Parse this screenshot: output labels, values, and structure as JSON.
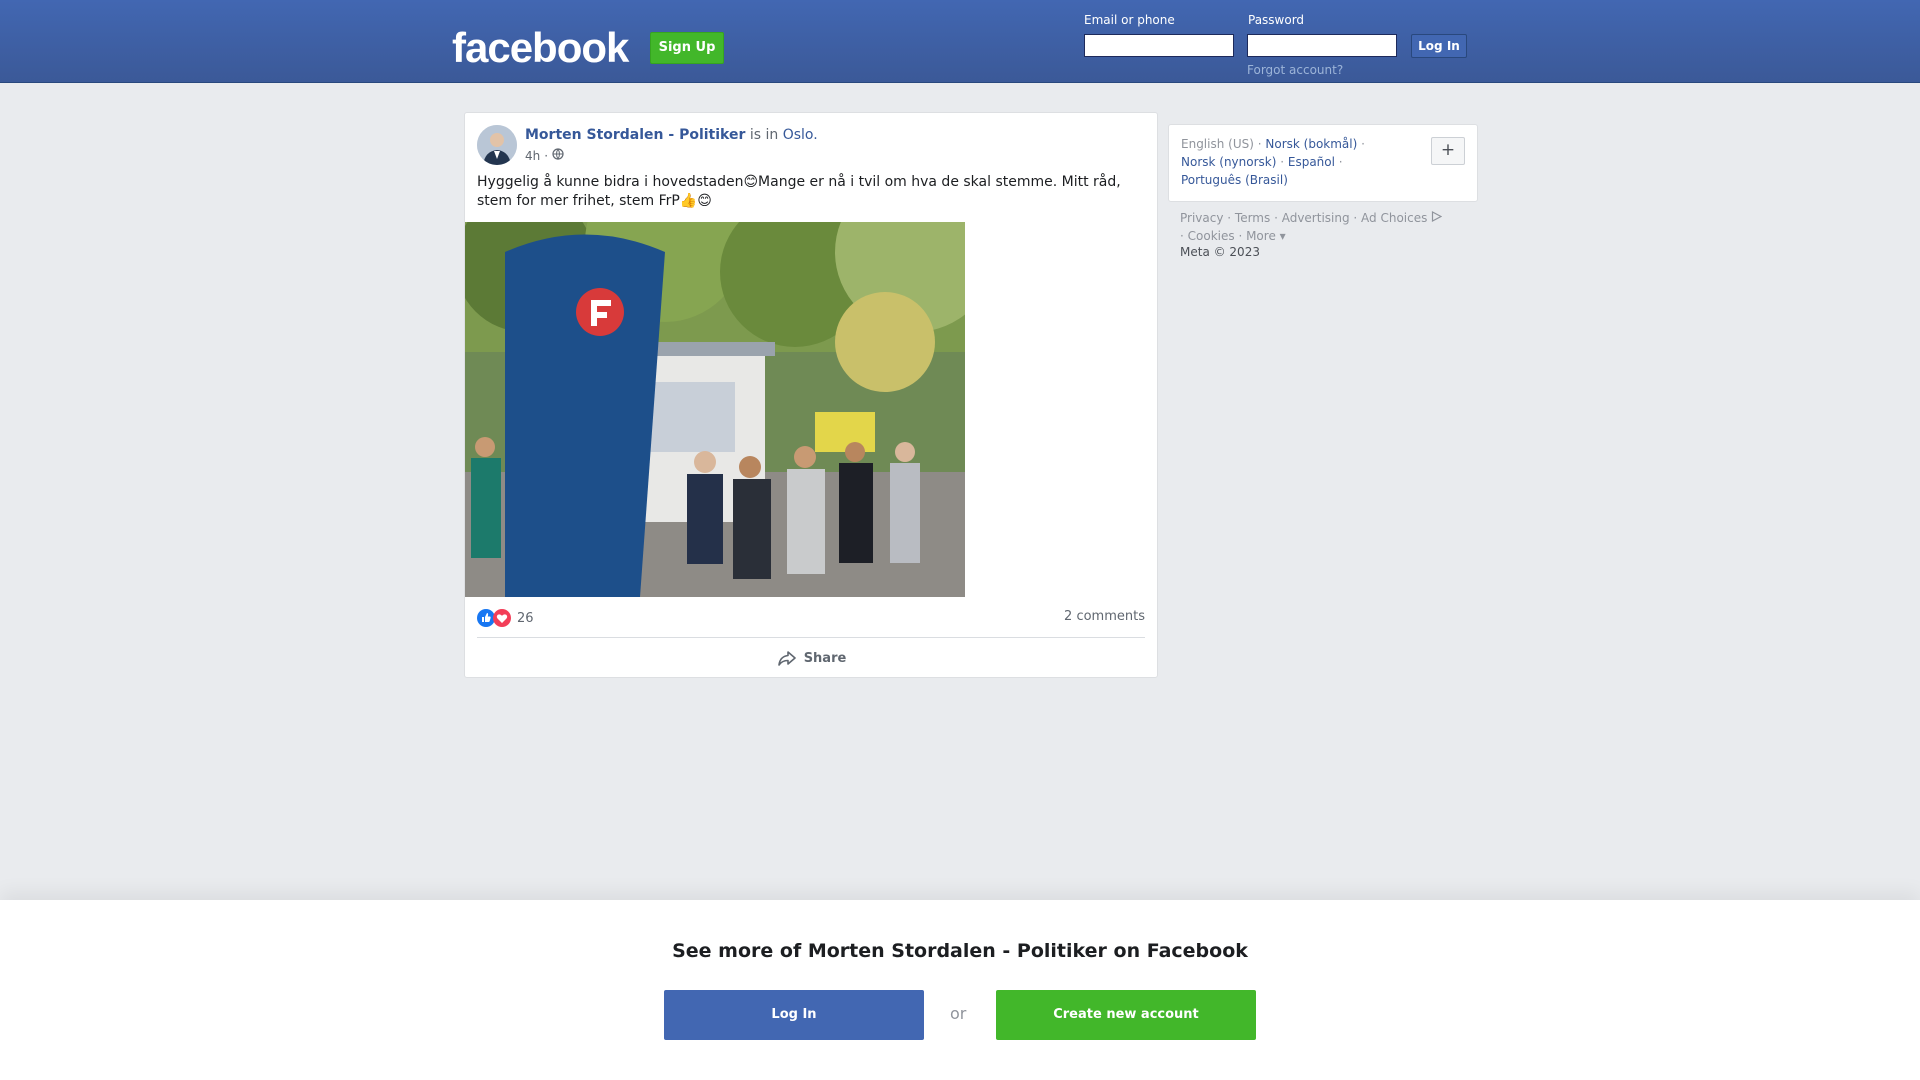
{
  "header": {
    "logo": "facebook",
    "signup_label": "Sign Up",
    "email_label": "Email or phone",
    "email_value": "",
    "password_label": "Password",
    "password_value": "",
    "login_label": "Log In",
    "forgot_label": "Forgot account?"
  },
  "post": {
    "author": "Morten Stordalen - Politiker",
    "is_in": "is in",
    "place": "Oslo.",
    "time": "4h",
    "visibility_icon": "globe-icon",
    "text": "Hyggelig å kunne bidra i hovedstaden😊Mange er nå i tvil om hva de skal stemme. Mitt råd, stem for mer frihet, stem FrP👍😊",
    "reaction_icons": [
      "like-icon",
      "love-icon"
    ],
    "reaction_count": "26",
    "comments": "2 comments",
    "share_label": "Share"
  },
  "sidebar": {
    "languages": [
      {
        "label": "English (US)",
        "current": true
      },
      {
        "label": "Norsk (bokmål)",
        "current": false
      },
      {
        "label": "Norsk (nynorsk)",
        "current": false
      },
      {
        "label": "Español",
        "current": false
      },
      {
        "label": "Português (Brasil)",
        "current": false
      }
    ],
    "plus_label": "+",
    "footer": [
      "Privacy",
      "Terms",
      "Advertising",
      "Ad Choices",
      "Cookies",
      "More"
    ],
    "copyright": "Meta © 2023"
  },
  "bottom": {
    "title": "See more of Morten Stordalen - Politiker on Facebook",
    "login_label": "Log In",
    "or_label": "or",
    "create_label": "Create new account"
  },
  "colors": {
    "brand_blue": "#4267b2",
    "link_blue": "#365899",
    "green": "#42b72a"
  }
}
